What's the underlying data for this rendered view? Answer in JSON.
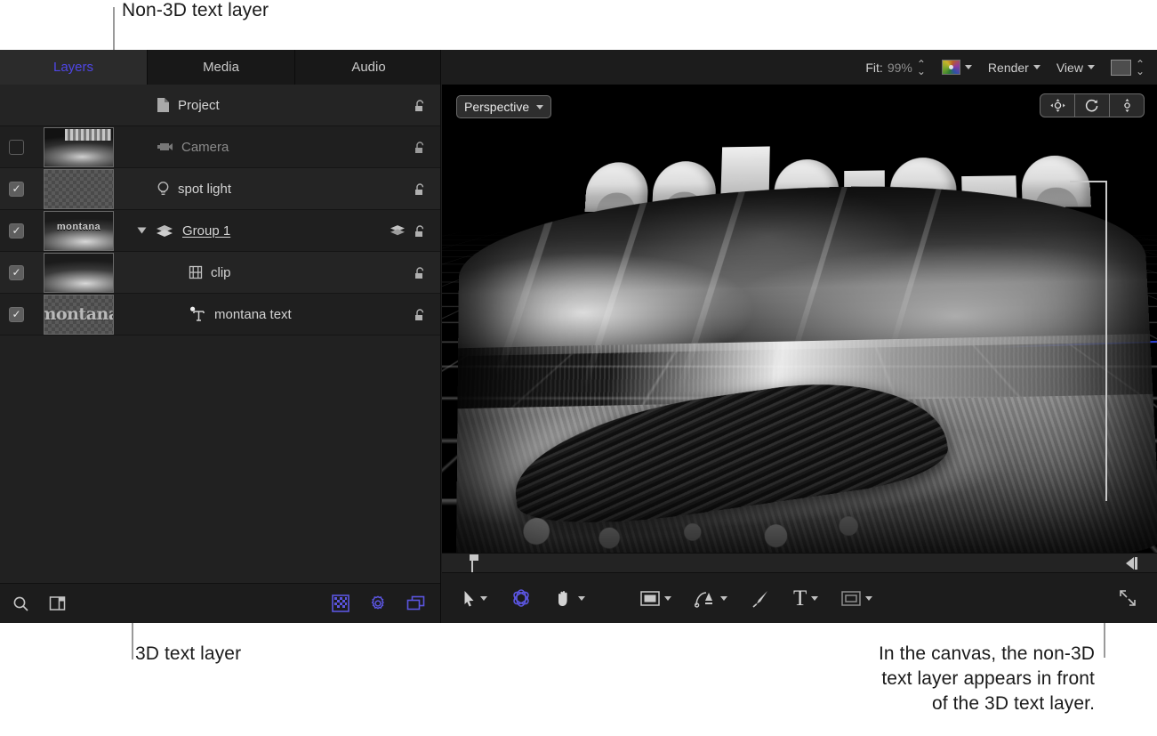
{
  "annotations": {
    "top": "Non-3D text layer",
    "bottom_left": "3D text layer",
    "bottom_right": "In the canvas, the non-3D\ntext layer appears in front\nof the 3D text layer."
  },
  "colors": {
    "accent": "#4f46e5",
    "panel_bg": "#222222",
    "toolbar_bg": "#1c1c1c",
    "text": "#d3d3d3",
    "leader_line": "#9a9a9a"
  },
  "left_panel": {
    "tabs": [
      {
        "label": "Layers",
        "selected": true
      },
      {
        "label": "Media",
        "selected": false
      },
      {
        "label": "Audio",
        "selected": false
      }
    ],
    "layers": [
      {
        "name": "Project",
        "checkbox": "none",
        "thumbnail": "none",
        "icon": "project-document-icon",
        "indent": "root",
        "dimmed": false,
        "lock_icon": "unlocked-padlock-icon"
      },
      {
        "name": "Camera",
        "checkbox": "off",
        "thumbnail": "camera-view-thumbnail",
        "icon": "camera-icon",
        "indent": "root",
        "dimmed": true,
        "lock_icon": "unlocked-padlock-icon"
      },
      {
        "name": "spot light",
        "checkbox": "on",
        "thumbnail": "empty-thumbnail",
        "icon": "spot-light-icon",
        "indent": "root",
        "dimmed": false,
        "lock_icon": "unlocked-padlock-icon"
      },
      {
        "name": "Group 1",
        "checkbox": "on",
        "thumbnail": "group-thumbnail",
        "icon": "group-3d-icon",
        "indent": "group",
        "dimmed": false,
        "disclosure": "expanded",
        "extra_icon": "3d-group-badge-icon",
        "lock_icon": "unlocked-padlock-icon"
      },
      {
        "name": "clip",
        "checkbox": "on",
        "thumbnail": "clip-thumbnail",
        "icon": "film-clip-icon",
        "indent": "child",
        "dimmed": false,
        "lock_icon": "unlocked-padlock-icon"
      },
      {
        "name": "montana text",
        "checkbox": "on",
        "thumbnail": "montana-text-thumbnail",
        "thumbnail_text": "montana",
        "icon": "3d-text-icon",
        "indent": "child",
        "dimmed": false,
        "lock_icon": "unlocked-padlock-icon"
      }
    ],
    "bottom_toolbar": {
      "left": [
        {
          "name": "search-icon",
          "label": "Search"
        },
        {
          "name": "show-hide-pane-icon",
          "label": "Show/Hide Pane"
        }
      ],
      "right": [
        {
          "name": "checkerboard-transparency-icon",
          "label": "Transparency"
        },
        {
          "name": "gear-icon",
          "label": "Settings"
        },
        {
          "name": "layers-stack-icon",
          "label": "Layers"
        }
      ]
    }
  },
  "canvas": {
    "top_toolbar": {
      "fit_label": "Fit:",
      "fit_value": "99%",
      "color_swatch": "color-gradient-swatch",
      "render_label": "Render",
      "view_label": "View",
      "background_swatch": "background-color-swatch"
    },
    "view_popup": {
      "label": "Perspective"
    },
    "view_controls": [
      {
        "name": "pan-3d-view-icon",
        "label": "Pan"
      },
      {
        "name": "orbit-3d-view-icon",
        "label": "Orbit"
      },
      {
        "name": "dolly-3d-view-icon",
        "label": "Dolly"
      }
    ],
    "scene": {
      "text_3d": "montana",
      "photo_description": "black and white beach with driftwood log"
    },
    "bottom_toolbar": {
      "tools": [
        {
          "name": "selection-arrow-tool",
          "label": "Select/Transform",
          "has_menu": true,
          "active": false
        },
        {
          "name": "3d-transform-tool",
          "label": "3D Transform",
          "has_menu": false,
          "active": true
        },
        {
          "name": "pan-hand-tool",
          "label": "Pan",
          "has_menu": true,
          "active": false
        },
        {
          "name": "shape-rectangle-tool",
          "label": "Shape",
          "has_menu": true,
          "active": false
        },
        {
          "name": "bezier-pen-tool",
          "label": "Bezier",
          "has_menu": true,
          "active": false
        },
        {
          "name": "paint-stroke-tool",
          "label": "Paint Stroke",
          "has_menu": false,
          "active": false
        },
        {
          "name": "text-tool",
          "label": "T",
          "has_menu": true,
          "active": false
        },
        {
          "name": "mask-tool",
          "label": "Mask",
          "has_menu": true,
          "active": false
        }
      ],
      "resize_handle": "resize-canvas-icon"
    }
  }
}
